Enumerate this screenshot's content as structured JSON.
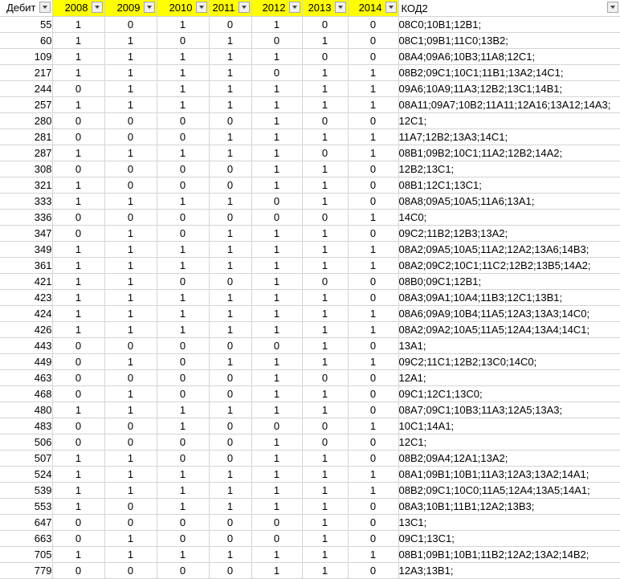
{
  "headers": {
    "debit": "Дебит",
    "y2008": "2008",
    "y2009": "2009",
    "y2010": "2010",
    "y2011": "2011",
    "y2012": "2012",
    "y2013": "2013",
    "y2014": "2014",
    "code": "КОД2"
  },
  "colors": {
    "year_header_bg": "#ffff00",
    "grid_line": "#d4d4d4"
  },
  "rows": [
    {
      "debit": "55",
      "y": [
        "1",
        "0",
        "1",
        "0",
        "1",
        "0",
        "0"
      ],
      "code": "08C0;10B1;12B1;"
    },
    {
      "debit": "60",
      "y": [
        "1",
        "1",
        "0",
        "1",
        "0",
        "1",
        "0"
      ],
      "code": "08C1;09B1;11C0;13B2;"
    },
    {
      "debit": "109",
      "y": [
        "1",
        "1",
        "1",
        "1",
        "1",
        "0",
        "0"
      ],
      "code": "08A4;09A6;10B3;11A8;12C1;"
    },
    {
      "debit": "217",
      "y": [
        "1",
        "1",
        "1",
        "1",
        "0",
        "1",
        "1"
      ],
      "code": "08B2;09C1;10C1;11B1;13A2;14C1;"
    },
    {
      "debit": "244",
      "y": [
        "0",
        "1",
        "1",
        "1",
        "1",
        "1",
        "1"
      ],
      "code": "09A6;10A9;11A3;12B2;13C1;14B1;"
    },
    {
      "debit": "257",
      "y": [
        "1",
        "1",
        "1",
        "1",
        "1",
        "1",
        "1"
      ],
      "code": "08A11;09A7;10B2;11A11;12A16;13A12;14A3;"
    },
    {
      "debit": "280",
      "y": [
        "0",
        "0",
        "0",
        "0",
        "1",
        "0",
        "0"
      ],
      "code": "12C1;"
    },
    {
      "debit": "281",
      "y": [
        "0",
        "0",
        "0",
        "1",
        "1",
        "1",
        "1"
      ],
      "code": "11A7;12B2;13A3;14C1;"
    },
    {
      "debit": "287",
      "y": [
        "1",
        "1",
        "1",
        "1",
        "1",
        "0",
        "1"
      ],
      "code": "08B1;09B2;10C1;11A2;12B2;14A2;"
    },
    {
      "debit": "308",
      "y": [
        "0",
        "0",
        "0",
        "0",
        "1",
        "1",
        "0"
      ],
      "code": "12B2;13C1;"
    },
    {
      "debit": "321",
      "y": [
        "1",
        "0",
        "0",
        "0",
        "1",
        "1",
        "0"
      ],
      "code": "08B1;12C1;13C1;"
    },
    {
      "debit": "333",
      "y": [
        "1",
        "1",
        "1",
        "1",
        "0",
        "1",
        "0"
      ],
      "code": "08A8;09A5;10A5;11A6;13A1;"
    },
    {
      "debit": "336",
      "y": [
        "0",
        "0",
        "0",
        "0",
        "0",
        "0",
        "1"
      ],
      "code": "14C0;"
    },
    {
      "debit": "347",
      "y": [
        "0",
        "1",
        "0",
        "1",
        "1",
        "1",
        "0"
      ],
      "code": "09C2;11B2;12B3;13A2;"
    },
    {
      "debit": "349",
      "y": [
        "1",
        "1",
        "1",
        "1",
        "1",
        "1",
        "1"
      ],
      "code": "08A2;09A5;10A5;11A2;12A2;13A6;14B3;"
    },
    {
      "debit": "361",
      "y": [
        "1",
        "1",
        "1",
        "1",
        "1",
        "1",
        "1"
      ],
      "code": "08A2;09C2;10C1;11C2;12B2;13B5;14A2;"
    },
    {
      "debit": "421",
      "y": [
        "1",
        "1",
        "0",
        "0",
        "1",
        "0",
        "0"
      ],
      "code": "08B0;09C1;12B1;"
    },
    {
      "debit": "423",
      "y": [
        "1",
        "1",
        "1",
        "1",
        "1",
        "1",
        "0"
      ],
      "code": "08A3;09A1;10A4;11B3;12C1;13B1;"
    },
    {
      "debit": "424",
      "y": [
        "1",
        "1",
        "1",
        "1",
        "1",
        "1",
        "1"
      ],
      "code": "08A6;09A9;10B4;11A5;12A3;13A3;14C0;"
    },
    {
      "debit": "426",
      "y": [
        "1",
        "1",
        "1",
        "1",
        "1",
        "1",
        "1"
      ],
      "code": "08A2;09A2;10A5;11A5;12A4;13A4;14C1;"
    },
    {
      "debit": "443",
      "y": [
        "0",
        "0",
        "0",
        "0",
        "0",
        "1",
        "0"
      ],
      "code": "13A1;"
    },
    {
      "debit": "449",
      "y": [
        "0",
        "1",
        "0",
        "1",
        "1",
        "1",
        "1"
      ],
      "code": "09C2;11C1;12B2;13C0;14C0;"
    },
    {
      "debit": "463",
      "y": [
        "0",
        "0",
        "0",
        "0",
        "1",
        "0",
        "0"
      ],
      "code": "12A1;"
    },
    {
      "debit": "468",
      "y": [
        "0",
        "1",
        "0",
        "0",
        "1",
        "1",
        "0"
      ],
      "code": "09C1;12C1;13C0;"
    },
    {
      "debit": "480",
      "y": [
        "1",
        "1",
        "1",
        "1",
        "1",
        "1",
        "0"
      ],
      "code": "08A7;09C1;10B3;11A3;12A5;13A3;"
    },
    {
      "debit": "483",
      "y": [
        "0",
        "0",
        "1",
        "0",
        "0",
        "0",
        "1"
      ],
      "code": "10C1;14A1;"
    },
    {
      "debit": "506",
      "y": [
        "0",
        "0",
        "0",
        "0",
        "1",
        "0",
        "0"
      ],
      "code": "12C1;"
    },
    {
      "debit": "507",
      "y": [
        "1",
        "1",
        "0",
        "0",
        "1",
        "1",
        "0"
      ],
      "code": "08B2;09A4;12A1;13A2;"
    },
    {
      "debit": "524",
      "y": [
        "1",
        "1",
        "1",
        "1",
        "1",
        "1",
        "1"
      ],
      "code": "08A1;09B1;10B1;11A3;12A3;13A2;14A1;"
    },
    {
      "debit": "539",
      "y": [
        "1",
        "1",
        "1",
        "1",
        "1",
        "1",
        "1"
      ],
      "code": "08B2;09C1;10C0;11A5;12A4;13A5;14A1;"
    },
    {
      "debit": "553",
      "y": [
        "1",
        "0",
        "1",
        "1",
        "1",
        "1",
        "0"
      ],
      "code": "08A3;10B1;11B1;12A2;13B3;"
    },
    {
      "debit": "647",
      "y": [
        "0",
        "0",
        "0",
        "0",
        "0",
        "1",
        "0"
      ],
      "code": "13C1;"
    },
    {
      "debit": "663",
      "y": [
        "0",
        "1",
        "0",
        "0",
        "0",
        "1",
        "0"
      ],
      "code": "09C1;13C1;"
    },
    {
      "debit": "705",
      "y": [
        "1",
        "1",
        "1",
        "1",
        "1",
        "1",
        "1"
      ],
      "code": "08B1;09B1;10B1;11B2;12A2;13A2;14B2;"
    },
    {
      "debit": "779",
      "y": [
        "0",
        "0",
        "0",
        "0",
        "1",
        "1",
        "0"
      ],
      "code": "12A3;13B1;"
    }
  ]
}
